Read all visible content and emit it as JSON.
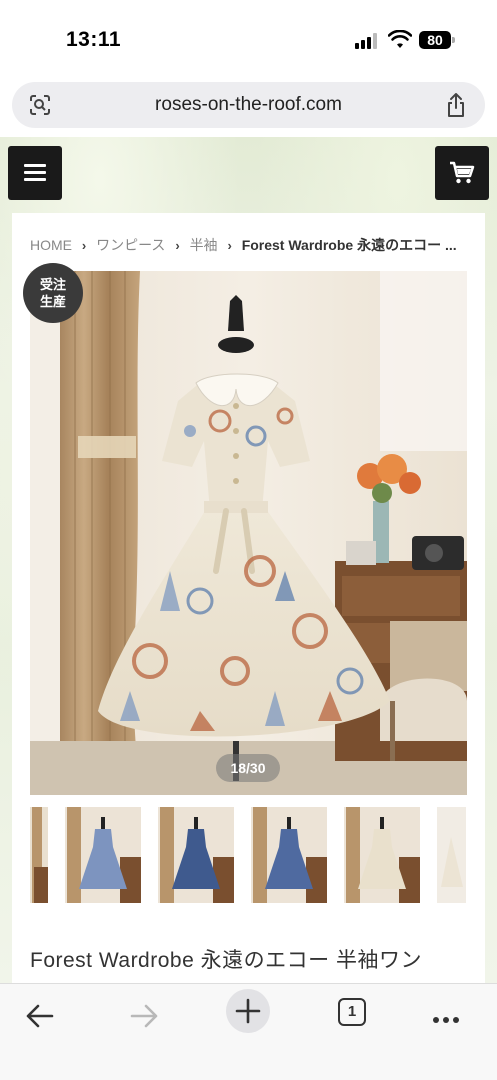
{
  "status_bar": {
    "time": "13:11",
    "battery": "80",
    "icons": [
      "signal-icon",
      "wifi-icon",
      "battery-icon"
    ]
  },
  "browser": {
    "url": "roses-on-the-roof.com",
    "icons": [
      "page-settings-icon",
      "share-icon"
    ]
  },
  "site_header": {
    "menu_icon": "hamburger-menu-icon",
    "cart_icon": "cart-icon"
  },
  "breadcrumb": {
    "items": [
      "HOME",
      "ワンピース",
      "半袖"
    ],
    "current": "Forest Wardrobe 永遠のエコー ..."
  },
  "gallery": {
    "badge": "受注\n生産",
    "badge_line1": "受注",
    "badge_line2": "生産",
    "counter": "18/30"
  },
  "product": {
    "title": "Forest Wardrobe 永遠のエコー 半袖ワン"
  },
  "toolbar": {
    "tab_count": "1",
    "icons": [
      "back-arrow-icon",
      "forward-arrow-icon",
      "plus-icon",
      "tabs-icon",
      "more-icon"
    ]
  },
  "colors": {
    "header_button": "#1a1a1a",
    "badge": "#3a3a3a",
    "url_bar": "#ededf0"
  }
}
